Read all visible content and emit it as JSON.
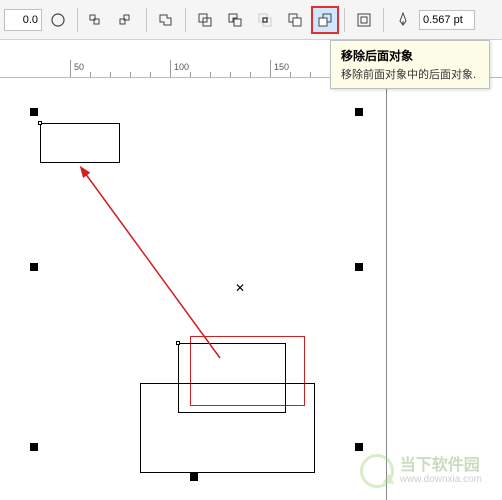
{
  "toolbar": {
    "value_input": "0.0",
    "pen_width": "0.567 pt"
  },
  "tooltip": {
    "title": "移除后面对象",
    "body": "移除前面对象中的后面对象."
  },
  "ruler": {
    "ticks": [
      50,
      100,
      150
    ]
  },
  "watermark": {
    "name": "当下软件园",
    "url": "www.downxia.com"
  }
}
